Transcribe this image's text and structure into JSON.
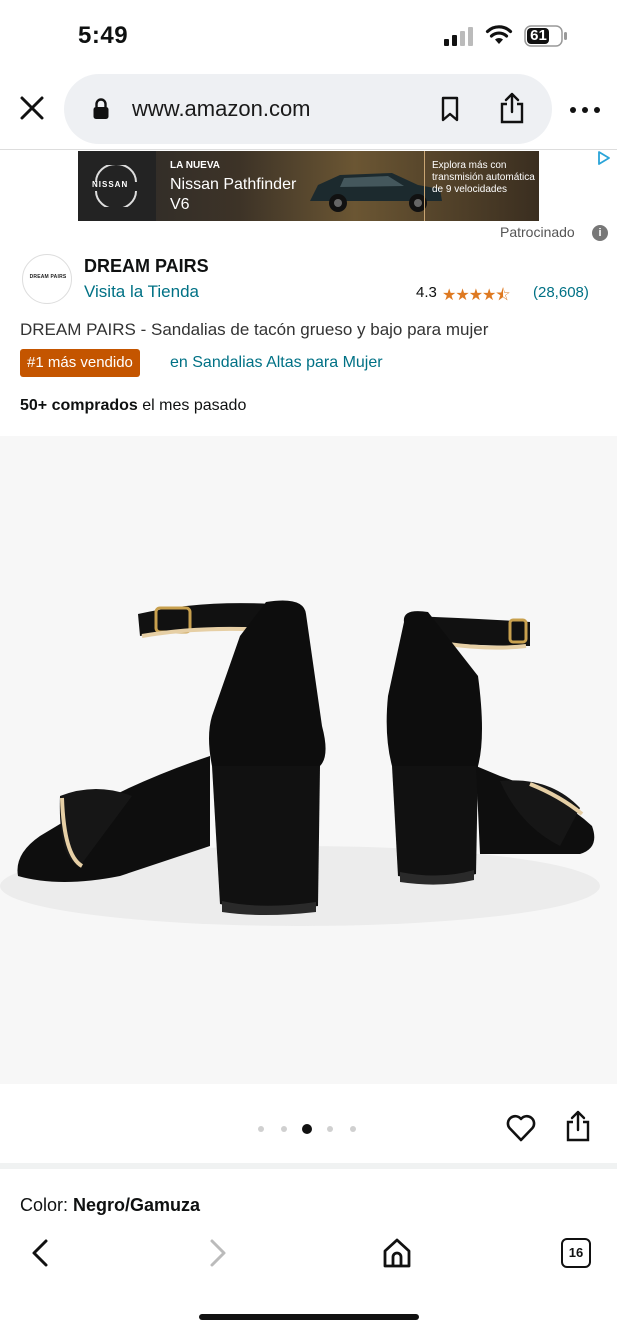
{
  "status_bar": {
    "time": "5:49",
    "battery": "61"
  },
  "browser": {
    "url": "www.amazon.com"
  },
  "ad": {
    "brand": "NISSAN",
    "tag": "LA NUEVA",
    "model": "Nissan Pathfinder V6",
    "promo": "Explora más con transmisión automática de 9 velocidades",
    "sponsored_label": "Patrocinado"
  },
  "store": {
    "logo_text": "DREAM PAIRS",
    "brand": "DREAM PAIRS",
    "visit_label": "Visita la Tienda",
    "rating": "4.3",
    "stars": 4.3,
    "rating_count": "(28,608)"
  },
  "product": {
    "title": "DREAM PAIRS - Sandalias de tacón grueso y bajo para mujer",
    "badge": "#1 más vendido",
    "badge_category": "en Sandalias Altas para Mujer",
    "bought_strong": "50+ comprados",
    "bought_rest": " el mes pasado",
    "image_index": 3,
    "image_count": 5
  },
  "color": {
    "label": "Color: ",
    "value": "Negro/Gamuza"
  },
  "nav": {
    "tabs_count": "16"
  },
  "colors": {
    "link": "#007185",
    "badge": "#c45500",
    "star": "#de7921"
  }
}
